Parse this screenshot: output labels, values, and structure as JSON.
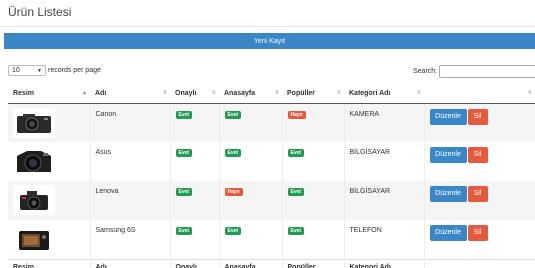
{
  "page": {
    "title": "Ürün Listesi",
    "new_button": "Yeni Kayıt"
  },
  "length_control": {
    "value": "10",
    "label": "records per page"
  },
  "search": {
    "label": "Search:",
    "value": ""
  },
  "table": {
    "headers": [
      "Resim",
      "Adı",
      "Onaylı",
      "Anasayfa",
      "Popüller",
      "Kategori Adı"
    ],
    "rows": [
      {
        "image": "canon-camera-image",
        "name": "Canon",
        "onayli": "Evet",
        "anasayfa": "Evet",
        "populer": "Hayır",
        "kategori": "KAMERA",
        "edit": "Düzenle",
        "delete": "Sil"
      },
      {
        "image": "asus-camera-image",
        "name": "Asus",
        "onayli": "Evet",
        "anasayfa": "Evet",
        "populer": "Evet",
        "kategori": "BİLGİSAYAR",
        "edit": "Düzenle",
        "delete": "Sil"
      },
      {
        "image": "lenova-camera-image",
        "name": "Lenova",
        "onayli": "Evet",
        "anasayfa": "Hayır",
        "populer": "Evet",
        "kategori": "BİLGİSAYAR",
        "edit": "Düzenle",
        "delete": "Sil"
      },
      {
        "image": "samsung-camera-image",
        "name": "Samsung 6S",
        "onayli": "Evet",
        "anasayfa": "Evet",
        "populer": "Evet",
        "kategori": "TELEFON",
        "edit": "Düzenle",
        "delete": "Sil"
      }
    ],
    "footer": [
      "Resim",
      "Adı",
      "Onaylı",
      "Anasayfa",
      "Popüller",
      "Kategori Adı"
    ]
  },
  "colors": {
    "primary": "#3a87c8",
    "danger": "#e55a3c",
    "success": "#1f9d55"
  }
}
